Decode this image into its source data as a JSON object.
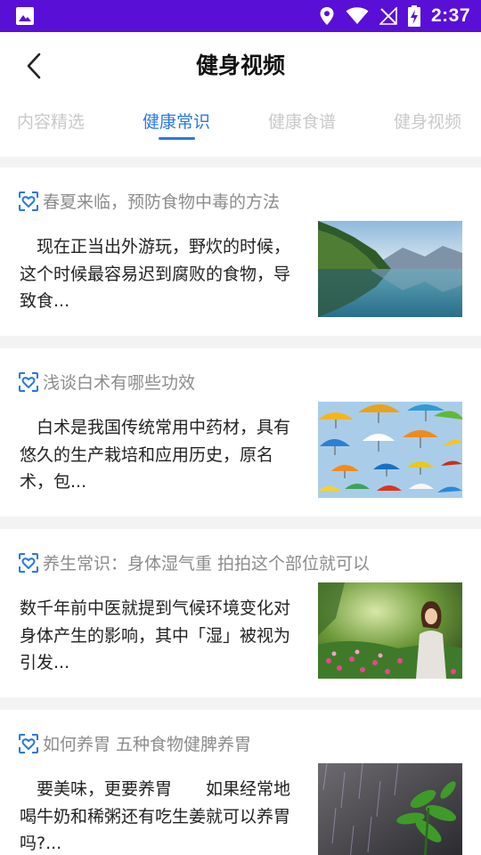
{
  "status_bar": {
    "time": "2:37"
  },
  "header": {
    "title": "健身视频"
  },
  "tabs": [
    {
      "label": "内容精选",
      "active": false
    },
    {
      "label": "健康常识",
      "active": true
    },
    {
      "label": "健康食谱",
      "active": false
    },
    {
      "label": "健身视频",
      "active": false
    }
  ],
  "articles": [
    {
      "title": "春夏来临，预防食物中毒的方法",
      "desc": "　现在正当出外游玩，野炊的时候，这个时候最容易迟到腐败的食物，导致食...",
      "thumb": "lake-mountain-reflection"
    },
    {
      "title": "浅谈白术有哪些功效",
      "desc": "　白术是我国传统常用中药材，具有悠久的生产栽培和应用历史，原名术，包...",
      "thumb": "colorful-umbrellas"
    },
    {
      "title": "养生常识：身体湿气重 拍拍这个部位就可以",
      "desc": "数千年前中医就提到气候环境变化对身体产生的影响，其中「湿」被视为引发...",
      "thumb": "woman-in-garden"
    },
    {
      "title": "如何养胃 五种食物健脾养胃",
      "desc": "　要美味，更要养胃　　如果经常地喝牛奶和稀粥还有吃生姜就可以养胃吗?...",
      "thumb": "plant-in-rain"
    }
  ],
  "colors": {
    "status_bar": "#5a0fd6",
    "accent": "#2a77e6",
    "tab_inactive": "#c9c9c9",
    "page_bg": "#f3f3f3"
  }
}
